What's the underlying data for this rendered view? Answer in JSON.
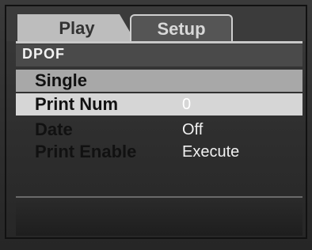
{
  "tabs": [
    {
      "label": "Play",
      "active": true
    },
    {
      "label": "Setup",
      "active": false
    }
  ],
  "section": {
    "title": "DPOF"
  },
  "menu": [
    {
      "label": "Single",
      "value": ""
    },
    {
      "label": "Print Num",
      "value": "0"
    },
    {
      "label": "Date",
      "value": "Off"
    },
    {
      "label": "Print Enable",
      "value": "Execute"
    }
  ],
  "colors": {
    "active_tab": "#bdbdbd",
    "highlight_row": "#d6d6d6",
    "background": "#2e2e2e"
  }
}
